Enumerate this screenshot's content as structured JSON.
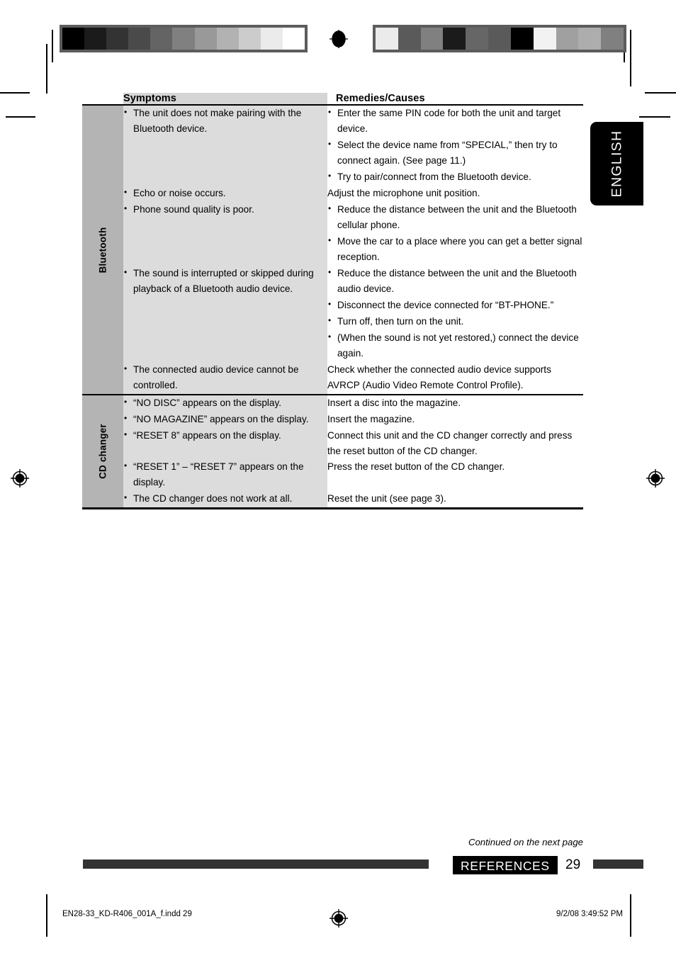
{
  "page": {
    "language_tab": "ENGLISH",
    "section_footer_label": "REFERENCES",
    "page_number": "29",
    "continued_note": "Continued on the next page",
    "doc_footer_left": "EN28-33_KD-R406_001A_f.indd   29",
    "doc_footer_right": "9/2/08   3:49:52 PM"
  },
  "colors": {
    "sidebar_gray": "#b4b4b4",
    "symptom_gray": "#dcdcdc",
    "header_gray": "#d5d5d5",
    "remedy_white": "#ffffff",
    "bar_dark": "#333333",
    "black": "#000000"
  },
  "calibration": {
    "left_swatches": [
      "#000000",
      "#1b1b1b",
      "#333333",
      "#4a4a4a",
      "#646464",
      "#808080",
      "#999999",
      "#b2b2b2",
      "#cccccc",
      "#ebebeb",
      "#ffffff"
    ],
    "right_swatches": [
      "#ebebeb",
      "#5a5a5a",
      "#808080",
      "#1b1b1b",
      "#666666",
      "#5a5a5a",
      "#000000",
      "#f2f2f2",
      "#a0a0a0",
      "#adadad",
      "#808080"
    ]
  },
  "table": {
    "headers": {
      "symptoms": "Symptoms",
      "remedies": "Remedies/Causes"
    },
    "sections": [
      {
        "label": "Bluetooth",
        "rows": [
          {
            "symptoms": [
              "The unit does not make pairing with the Bluetooth device."
            ],
            "symptoms_bulleted": true,
            "remedies": [
              "Enter the same PIN code for both the unit and target device.",
              "Select the device name from “SPECIAL,” then try to connect again. (See page 11.)",
              "Try to pair/connect from the Bluetooth device."
            ],
            "remedies_bulleted": true
          },
          {
            "symptoms": [
              "Echo or noise occurs."
            ],
            "symptoms_bulleted": true,
            "remedies": [
              "Adjust the microphone unit position."
            ],
            "remedies_bulleted": false
          },
          {
            "symptoms": [
              "Phone sound quality is poor."
            ],
            "symptoms_bulleted": true,
            "remedies": [
              "Reduce the distance between the unit and the Bluetooth cellular phone.",
              "Move the car to a place where you can get a better signal reception."
            ],
            "remedies_bulleted": true
          },
          {
            "symptoms": [
              "The sound is interrupted or skipped during playback of a Bluetooth audio device."
            ],
            "symptoms_bulleted": true,
            "remedies": [
              "Reduce the distance between the unit and the Bluetooth audio device.",
              "Disconnect the device connected for “BT-PHONE.”",
              "Turn off, then turn on the unit.",
              "(When the sound is not yet restored,) connect the device again."
            ],
            "remedies_bulleted": true
          },
          {
            "symptoms": [
              "The connected audio device cannot be controlled."
            ],
            "symptoms_bulleted": true,
            "remedies": [
              "Check whether the connected audio device supports AVRCP (Audio Video Remote Control Profile)."
            ],
            "remedies_bulleted": false
          }
        ]
      },
      {
        "label": "CD changer",
        "rows": [
          {
            "symptoms": [
              "“NO DISC” appears on the display."
            ],
            "symptoms_bulleted": true,
            "remedies": [
              "Insert a disc into the magazine."
            ],
            "remedies_bulleted": false
          },
          {
            "symptoms": [
              "“NO MAGAZINE” appears on the display."
            ],
            "symptoms_bulleted": true,
            "remedies": [
              "Insert the magazine."
            ],
            "remedies_bulleted": false
          },
          {
            "symptoms": [
              "“RESET 8” appears on the display."
            ],
            "symptoms_bulleted": true,
            "remedies": [
              "Connect this unit and the CD changer correctly and press the reset button of the CD changer."
            ],
            "remedies_bulleted": false
          },
          {
            "symptoms": [
              "“RESET 1” – “RESET 7” appears on the display."
            ],
            "symptoms_bulleted": true,
            "remedies": [
              "Press the reset button of the CD changer."
            ],
            "remedies_bulleted": false
          },
          {
            "symptoms": [
              "The CD changer does not work at all."
            ],
            "symptoms_bulleted": true,
            "remedies": [
              "Reset the unit (see page 3)."
            ],
            "remedies_bulleted": false
          }
        ]
      }
    ]
  }
}
